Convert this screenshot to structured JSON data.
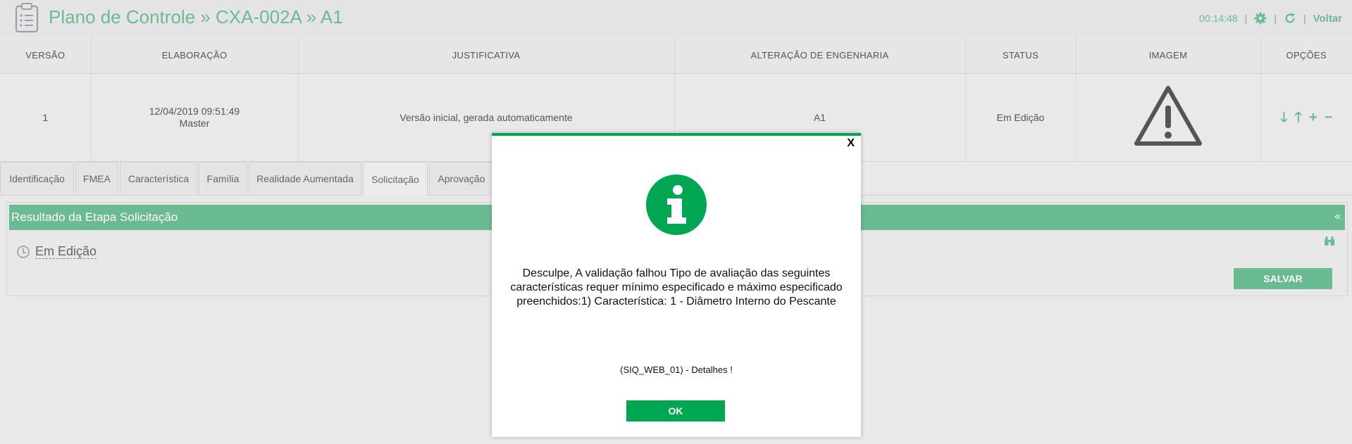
{
  "header": {
    "title": "Plano de Controle » CXA-002A » A1",
    "timer": "00:14:48",
    "separator": "|",
    "back_label": "Voltar",
    "icons": [
      "clipboard-icon",
      "gear-icon",
      "refresh-icon"
    ]
  },
  "versions_table": {
    "columns": [
      "VERSÃO",
      "ELABORAÇÃO",
      "JUSTIFICATIVA",
      "ALTERAÇÃO DE ENGENHARIA",
      "STATUS",
      "IMAGEM",
      "OPÇÕES"
    ],
    "row": {
      "version": "1",
      "date": "12/04/2019 09:51:49",
      "author": "Master",
      "justification": "Versão inicial, gerada automaticamente",
      "engineering_change": "A1",
      "status": "Em Edição",
      "image_icon": "warning-icon",
      "options": {
        "down": "🡓",
        "up": "🡑",
        "add": "+",
        "remove": "−"
      }
    }
  },
  "tabs": [
    {
      "label": "Identificação",
      "active": false
    },
    {
      "label": "FMEA",
      "active": false
    },
    {
      "label": "Característica",
      "active": false
    },
    {
      "label": "Família",
      "active": false
    },
    {
      "label": "Realidade Aumentada",
      "active": false
    },
    {
      "label": "Solicitação",
      "active": true
    },
    {
      "label": "Aprovação",
      "active": false
    }
  ],
  "panel": {
    "title": "Resultado da Etapa Solicitação",
    "collapse_glyph": "«",
    "status": "Em Edição",
    "save_label": "SALVAR"
  },
  "modal": {
    "close_label": "X",
    "icon": "info-icon",
    "message": "Desculpe, A validação falhou Tipo de avaliação das seguintes características requer mínimo especificado e máximo especificado preenchidos:1) Característica: 1 - Diâmetro Interno do Pescante",
    "code": "(SIQ_WEB_01) - Detalhes !",
    "ok_label": "OK"
  },
  "colors": {
    "accent": "#6bbb92",
    "modal_accent": "#00a651",
    "background": "#e9e9e9"
  }
}
